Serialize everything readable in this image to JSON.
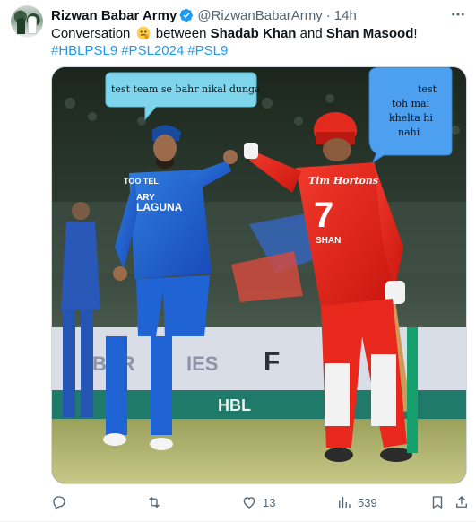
{
  "tweet": {
    "display_name": "Rizwan Babar Army",
    "handle": "@RizwanBabarArmy",
    "separator": "·",
    "time": "14h",
    "text_prefix": "Conversation",
    "text_between": "between",
    "name_one": "Shadab Khan",
    "text_and": "and",
    "name_two": "Shan Masood",
    "text_end": "!",
    "hashtags": [
      "#HBLPSL9",
      "#PSL2024",
      "#PSL9"
    ]
  },
  "media": {
    "bubble_left": "test team se bahr nikal dunga",
    "bubble_right_lines": [
      "test",
      "toh mai",
      "khelta hi",
      "nahi"
    ],
    "shirt_number": "7",
    "shirt_sponsor": "Tim Hortons",
    "shirt_name": "SHAN",
    "left_sponsor_1": "TOO TEL",
    "left_sponsor_2": "ARY",
    "left_sponsor_3": "LAGUNA",
    "board_1": "BAR",
    "board_2": "IES",
    "board_3": "HBL",
    "board_4": "F"
  },
  "actions": {
    "replies": "",
    "retweets": "",
    "likes": "13",
    "views": "539"
  },
  "colors": {
    "accent": "#1d9bf0",
    "text": "#0f1419",
    "muted": "#536471",
    "karachi_blue": "#1e5bd0",
    "islamabad_red": "#e8231c"
  },
  "icons": [
    "verified-badge-icon",
    "more-icon",
    "reply-icon",
    "retweet-icon",
    "like-icon",
    "views-icon",
    "bookmark-icon",
    "share-icon"
  ]
}
